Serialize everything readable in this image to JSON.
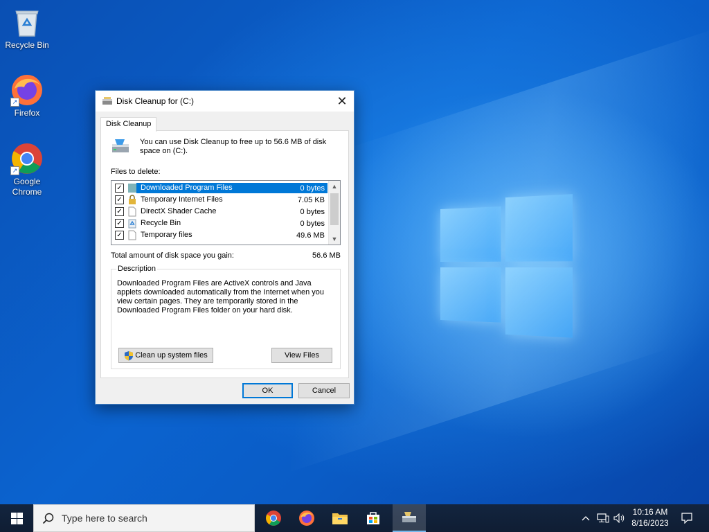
{
  "desktop": {
    "icons": [
      {
        "label": "Recycle Bin"
      },
      {
        "label": "Firefox"
      },
      {
        "label": "Google Chrome"
      }
    ]
  },
  "dialog": {
    "title": "Disk Cleanup for  (C:)",
    "close_glyph": "✕",
    "tab": "Disk Cleanup",
    "intro": "You can use Disk Cleanup to free up to 56.6 MB of disk space on  (C:).",
    "files_label": "Files to delete:",
    "files": [
      {
        "name": "Downloaded Program Files",
        "size": "0 bytes",
        "checked": true,
        "selected": true
      },
      {
        "name": "Temporary Internet Files",
        "size": "7.05 KB",
        "checked": true,
        "selected": false
      },
      {
        "name": "DirectX Shader Cache",
        "size": "0 bytes",
        "checked": true,
        "selected": false
      },
      {
        "name": "Recycle Bin",
        "size": "0 bytes",
        "checked": true,
        "selected": false
      },
      {
        "name": "Temporary files",
        "size": "49.6 MB",
        "checked": true,
        "selected": false
      }
    ],
    "total_label": "Total amount of disk space you gain:",
    "total_value": "56.6 MB",
    "description_legend": "Description",
    "description": "Downloaded Program Files are ActiveX controls and Java applets downloaded automatically from the Internet when you view certain pages. They are temporarily stored in the Downloaded Program Files folder on your hard disk.",
    "cleanup_system_label": "Clean up system files",
    "view_files_label": "View Files",
    "ok_label": "OK",
    "cancel_label": "Cancel"
  },
  "taskbar": {
    "search_placeholder": "Type here to search",
    "time": "10:16 AM",
    "date": "8/16/2023",
    "apps": [
      "chrome-icon",
      "firefox-icon",
      "file-explorer-icon",
      "store-icon",
      "disk-cleanup-icon"
    ]
  },
  "colors": {
    "selection": "#0078d7",
    "taskbar": "#10213a",
    "wallpaper": "#0a5fc4"
  }
}
